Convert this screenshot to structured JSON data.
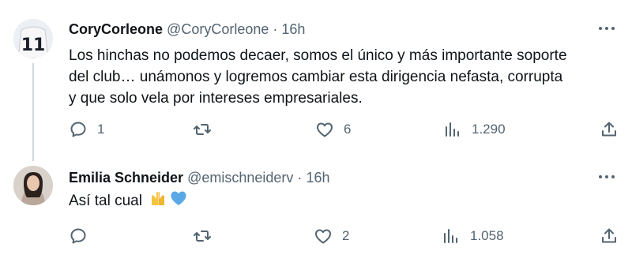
{
  "tweets": [
    {
      "name": "CoryCorleone",
      "handle": "@CoryCorleone",
      "separator": "·",
      "time": "16h",
      "avatar_text": "11",
      "text_lines": [
        "Los hinchas no podemos decaer, somos el único y más importante soporte",
        "del club… unámonos y logremos cambiar esta dirigencia nefasta, corrupta",
        "y que solo vela por intereses empresariales."
      ],
      "replies": "1",
      "retweets": "",
      "likes": "6",
      "views": "1.290"
    },
    {
      "name": "Emilia Schneider",
      "handle": "@emischneiderv",
      "separator": "·",
      "time": "16h",
      "text": "Así tal cual",
      "emojis": [
        "raising-hands-emoji",
        "blue-heart-emoji"
      ],
      "replies": "",
      "retweets": "",
      "likes": "2",
      "views": "1.058"
    }
  ],
  "colors": {
    "text": "#0f1419",
    "secondary": "#536471",
    "thread_line": "#cfd9de",
    "heart_emoji": "#5aa9e6",
    "hands_emoji": "#f5c542"
  }
}
